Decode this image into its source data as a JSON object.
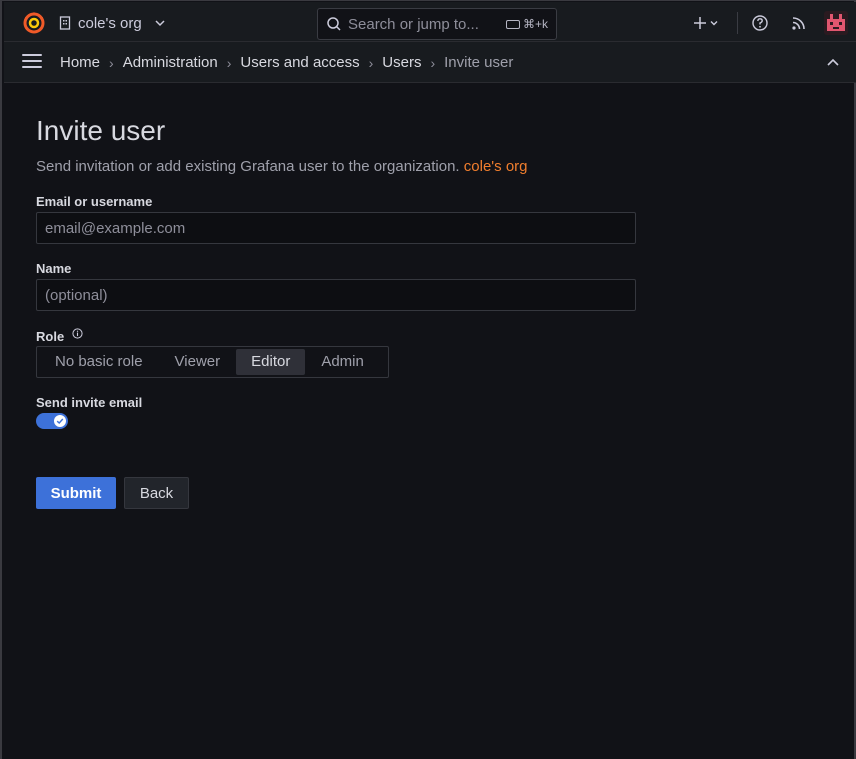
{
  "topbar": {
    "org_name": "cole's org",
    "search_placeholder": "Search or jump to...",
    "search_shortcut": "⌘+k"
  },
  "breadcrumb": {
    "items": [
      "Home",
      "Administration",
      "Users and access",
      "Users",
      "Invite user"
    ]
  },
  "page": {
    "title": "Invite user",
    "subtitle": "Send invitation or add existing Grafana user to the organization.",
    "org_link": "cole's org"
  },
  "form": {
    "email": {
      "label": "Email or username",
      "placeholder": "email@example.com",
      "value": ""
    },
    "name": {
      "label": "Name",
      "placeholder": "(optional)",
      "value": ""
    },
    "role": {
      "label": "Role",
      "options": [
        "No basic role",
        "Viewer",
        "Editor",
        "Admin"
      ],
      "selected": "Editor"
    },
    "send_invite": {
      "label": "Send invite email",
      "checked": true
    },
    "submit_label": "Submit",
    "back_label": "Back"
  },
  "colors": {
    "accent": "#3d71d9",
    "brand": "#f07e2e",
    "background": "#111217"
  },
  "icons": [
    "grafana-logo-icon",
    "org-icon",
    "chevron-down-icon",
    "search-icon",
    "keyboard-icon",
    "plus-icon",
    "help-icon",
    "rss-icon",
    "avatar",
    "menu-icon",
    "chevron-right-icon",
    "chevron-up-icon",
    "info-icon",
    "check-icon"
  ]
}
